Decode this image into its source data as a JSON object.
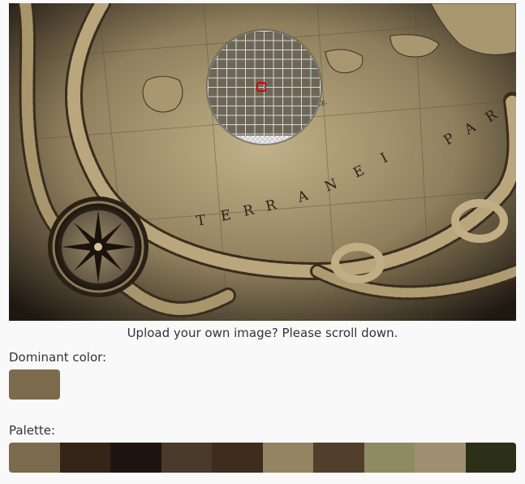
{
  "hint_text": "Upload your own image? Please scroll down.",
  "dominant": {
    "label": "Dominant color:",
    "color": "#7b6b4c"
  },
  "palette": {
    "label": "Palette:",
    "colors": [
      "#7b6b4c",
      "#352518",
      "#1f1410",
      "#4a3a2b",
      "#3e2d1c",
      "#948462",
      "#523f2b",
      "#8e8b63",
      "#a08f70",
      "#2d3019"
    ]
  },
  "map_letters": [
    "T",
    "E",
    "R",
    "R",
    "A",
    "N",
    "E",
    "I",
    "P",
    "A",
    "R"
  ],
  "map_small_text": "·CCE·"
}
